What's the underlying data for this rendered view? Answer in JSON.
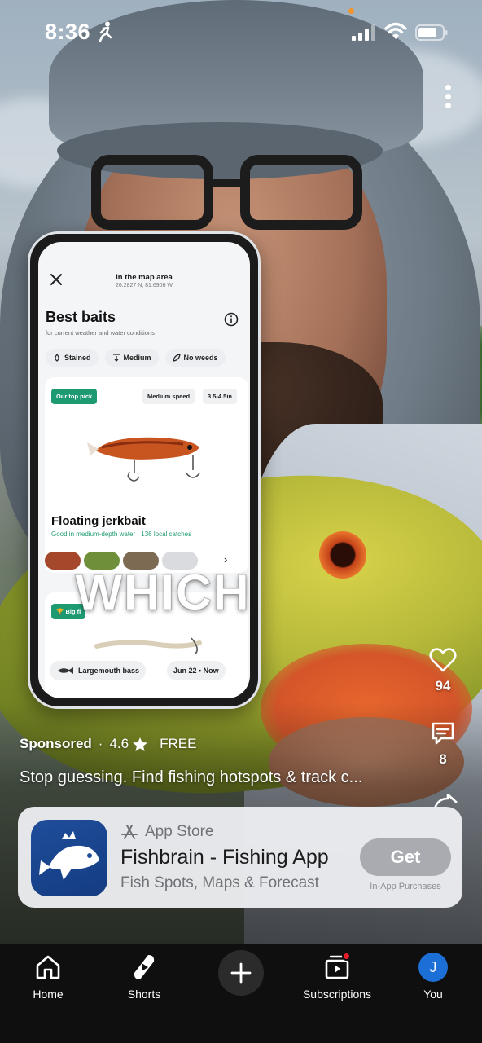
{
  "status_bar": {
    "time": "8:36"
  },
  "phone_app": {
    "map_title": "In the map area",
    "map_coords": "26.2827 N, 81.6906 W",
    "title": "Best baits",
    "subtitle": "for current weather and water conditions",
    "chips": [
      "Stained",
      "Medium",
      "No weeds"
    ],
    "top_pick": "Our top pick",
    "speed_tag": "Medium speed",
    "size_tag": "3.5-4.5in",
    "bait_name": "Floating jerkbait",
    "bait_desc": "Good in medium-depth water · 136 local catches",
    "second_card_tag": "Big fi",
    "footer_species": "Largemouth bass",
    "footer_date": "Jun 22 • Now"
  },
  "overlay_text": "WHICH",
  "actions": {
    "likes": "94",
    "comments": "8"
  },
  "ad": {
    "sponsored": "Sponsored",
    "rating": "4.6",
    "price": "FREE",
    "text": "Stop guessing. Find fishing hotspots & track c...",
    "store": "App Store",
    "app_name": "Fishbrain - Fishing App",
    "app_subtitle": "Fish Spots, Maps & Forecast",
    "get_label": "Get",
    "iap_label": "In-App Purchases"
  },
  "nav": {
    "home": "Home",
    "shorts": "Shorts",
    "subscriptions": "Subscriptions",
    "you": "You",
    "avatar_letter": "J"
  },
  "colors": {
    "accent_green": "#1e9a73",
    "app_icon_blue": "#1f4d9a",
    "avatar_blue": "#1b6fd6",
    "notif_red": "#e41e2a"
  }
}
